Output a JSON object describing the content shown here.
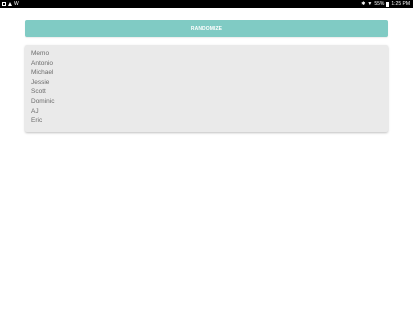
{
  "status_bar": {
    "left_icons": [
      "image-icon",
      "warning-icon",
      "signal-icon"
    ],
    "signal_text": "W",
    "bluetooth_glyph": "✱",
    "wifi_glyph": "▼",
    "battery_text": "55%",
    "time": "1:25 PM"
  },
  "randomize_button": {
    "label": "RANDOMIZE"
  },
  "names": [
    "Memo",
    "Antonio",
    "Michael",
    "Jessie",
    "Scott",
    "Dominic",
    "AJ",
    "Eric"
  ],
  "colors": {
    "accent": "#80cbc4",
    "card_background": "#eaeaea",
    "name_text": "#6b6b6b"
  }
}
